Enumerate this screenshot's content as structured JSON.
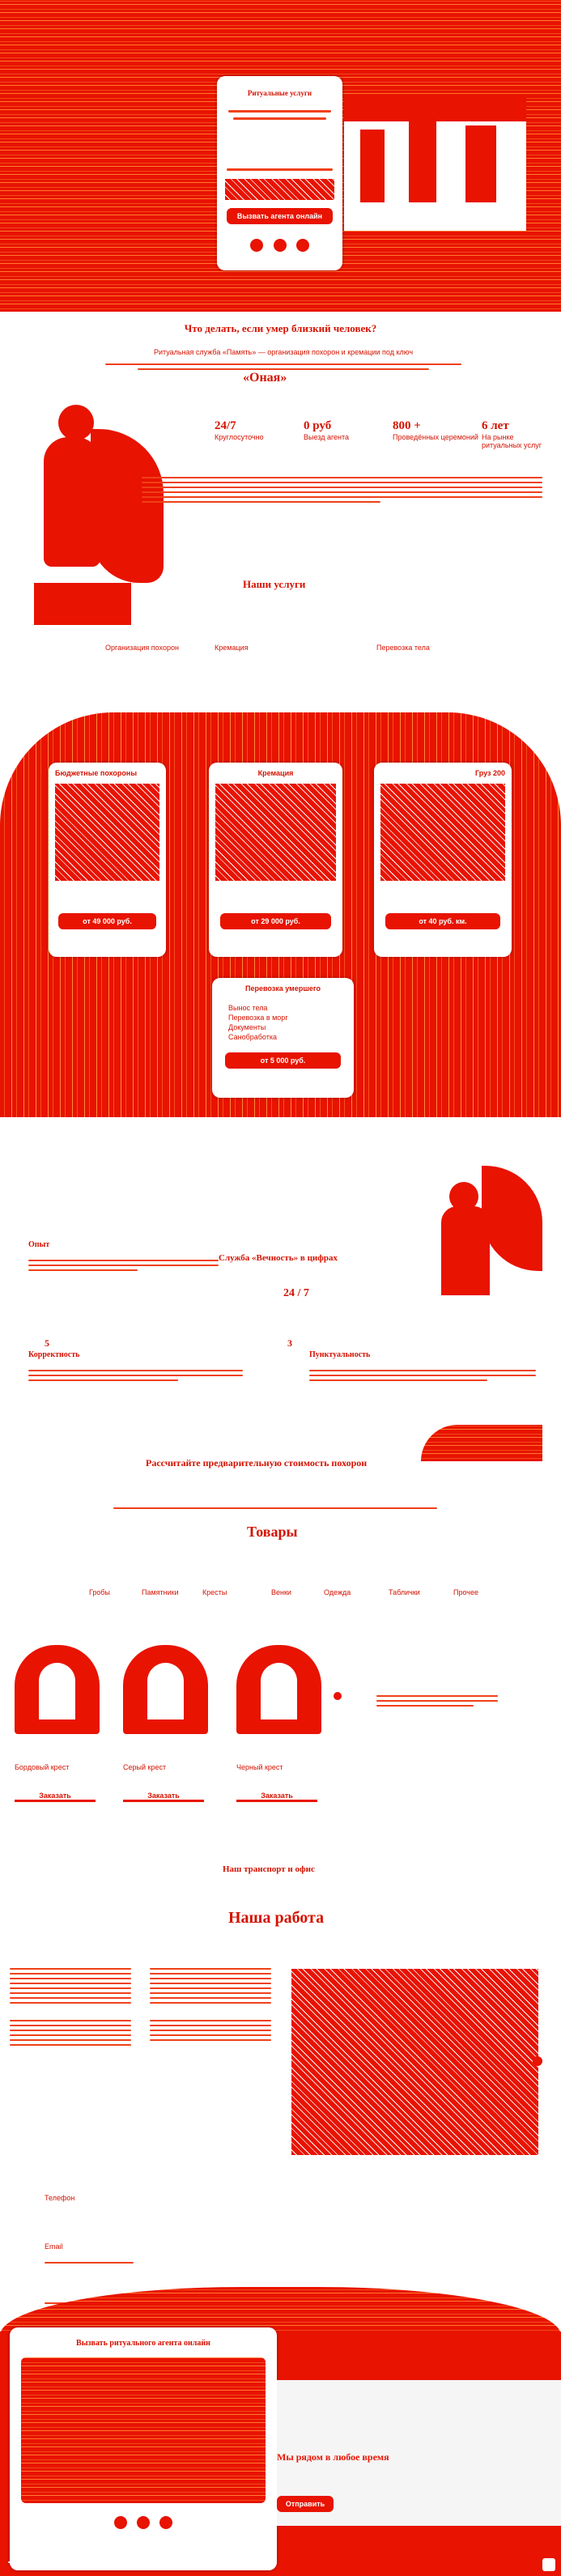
{
  "hero": {
    "title": "Что делать, если умер близкий человек?",
    "card_heading": "Ритуальные услуги",
    "card_button": "Вызвать агента онлайн"
  },
  "about": {
    "intro": "Ритуальная служба «Память» — организация похорон и кремации под ключ",
    "brand": "«Оная»",
    "stats": [
      {
        "value": "24/7",
        "label": "Круглосуточно"
      },
      {
        "value": "0 руб",
        "label": "Выезд агента"
      },
      {
        "value": "800 +",
        "label": "Проведённых церемоний"
      },
      {
        "value": "6 лет",
        "label": "На рынке ритуальных услуг"
      }
    ],
    "services_title": "Наши услуги",
    "services": [
      "Организация похорон",
      "Кремация",
      "Перевозка тела"
    ]
  },
  "pricing": {
    "cards": [
      {
        "title": "Бюджетные похороны",
        "price": "от 49 000 руб."
      },
      {
        "title": "Кремация",
        "price": "от 29 000 руб."
      },
      {
        "title": "Груз 200",
        "price": "от 40 руб. км."
      }
    ],
    "extra": {
      "title": "Перевозка умершего",
      "items": [
        "Вынос тела",
        "Перевозка в морг",
        "Документы",
        "Санобработка"
      ],
      "price": "от 5 000 руб."
    }
  },
  "numbers": {
    "title": "Служба «Вечность» в цифрах",
    "value": "24 / 7",
    "left_title": "Опыт",
    "left2_title": "Корректность",
    "right_title": "Пунктуальность",
    "badge1": "5",
    "badge2": "3",
    "cta": "Рассчитайте предварительную стоимость похорон"
  },
  "goods": {
    "title": "Товары",
    "tabs": [
      "Гробы",
      "Памятники",
      "Кресты",
      "Венки",
      "Одежда",
      "Таблички",
      "Прочее"
    ],
    "items": [
      {
        "name": "Бордовый крест",
        "button": "Заказать"
      },
      {
        "name": "Серый крест",
        "button": "Заказать"
      },
      {
        "name": "Черный крест",
        "button": "Заказать"
      }
    ]
  },
  "work": {
    "transport_title": "Наш транспорт и офис",
    "title": "Наша работа",
    "contacts_label": "Телефон",
    "email_label": "Email"
  },
  "footer": {
    "form_title": "Вызвать ритуального агента онлайн",
    "headline": "Мы рядом в любое время",
    "submit": "Отправить"
  },
  "colors": {
    "primary": "#e81300"
  }
}
